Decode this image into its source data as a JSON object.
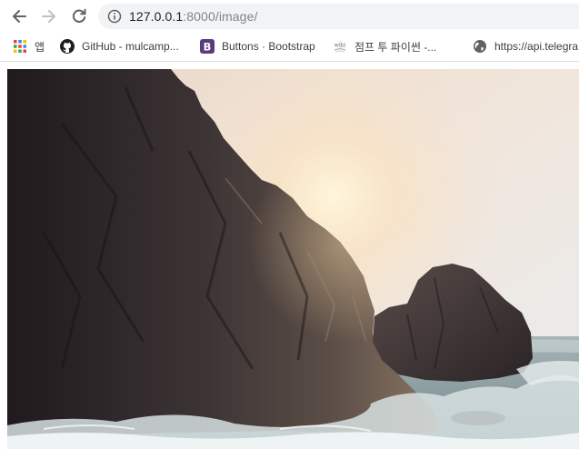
{
  "browser": {
    "url_host": "127.0.0.1",
    "url_rest": ":8000/image/",
    "icons": {
      "back": "arrow-left-icon",
      "forward": "arrow-right-icon",
      "reload": "reload-icon",
      "site_info": "info-icon"
    }
  },
  "bookmarks": [
    {
      "label": "앱",
      "icon": "apps-grid-icon"
    },
    {
      "label": "GitHub - mulcamp...",
      "icon": "github-icon"
    },
    {
      "label": "Buttons · Bootstrap",
      "icon": "bootstrap-icon"
    },
    {
      "label": "점프 투 파이썬 -...",
      "icon": "wikidocs-icon",
      "icon_text": "wiki"
    },
    {
      "label": "https://api.telegra",
      "icon": "globe-icon"
    }
  ],
  "page": {
    "image": {
      "subject": "sea-cliff-photo"
    }
  }
}
